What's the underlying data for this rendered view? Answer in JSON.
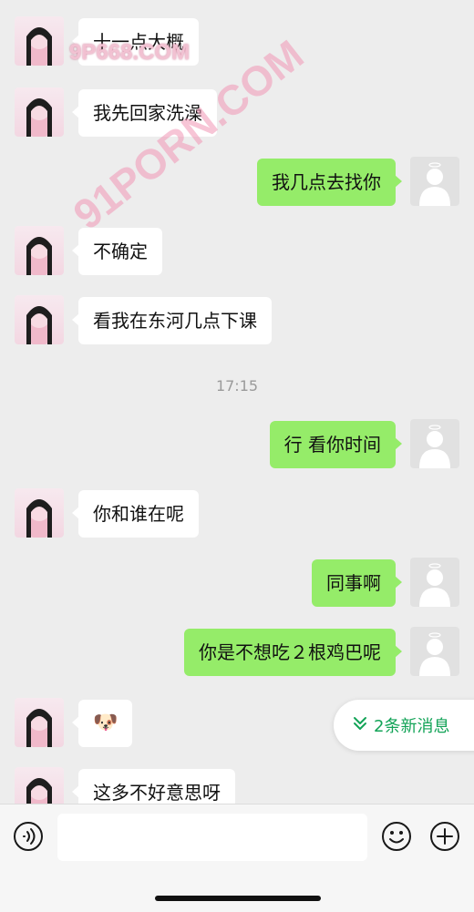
{
  "messages": [
    {
      "side": "in",
      "text": "十一点大概"
    },
    {
      "side": "in",
      "text": "我先回家洗澡"
    },
    {
      "side": "out",
      "text": "我几点去找你"
    },
    {
      "side": "in",
      "text": "不确定"
    },
    {
      "side": "in",
      "text": "看我在东河几点下课"
    },
    {
      "side": "out",
      "text": "行 看你时间"
    },
    {
      "side": "in",
      "text": "你和谁在呢"
    },
    {
      "side": "out",
      "text": "同事啊"
    },
    {
      "side": "out",
      "text": "你是不想吃２根鸡巴呢"
    },
    {
      "side": "in",
      "text": "🐶"
    },
    {
      "side": "in",
      "text": "这多不好意思呀"
    }
  ],
  "timestamp": "17:15",
  "new_messages": {
    "label": "2条新消息",
    "icon": "double-chevron-down-icon"
  },
  "watermarks": {
    "top": "9P668.COM",
    "diagonal": "91PORN.COM"
  },
  "input": {
    "placeholder": ""
  },
  "colors": {
    "outgoing_bubble": "#95ec69",
    "incoming_bubble": "#ffffff",
    "accent": "#12a357",
    "background": "#ededed"
  }
}
